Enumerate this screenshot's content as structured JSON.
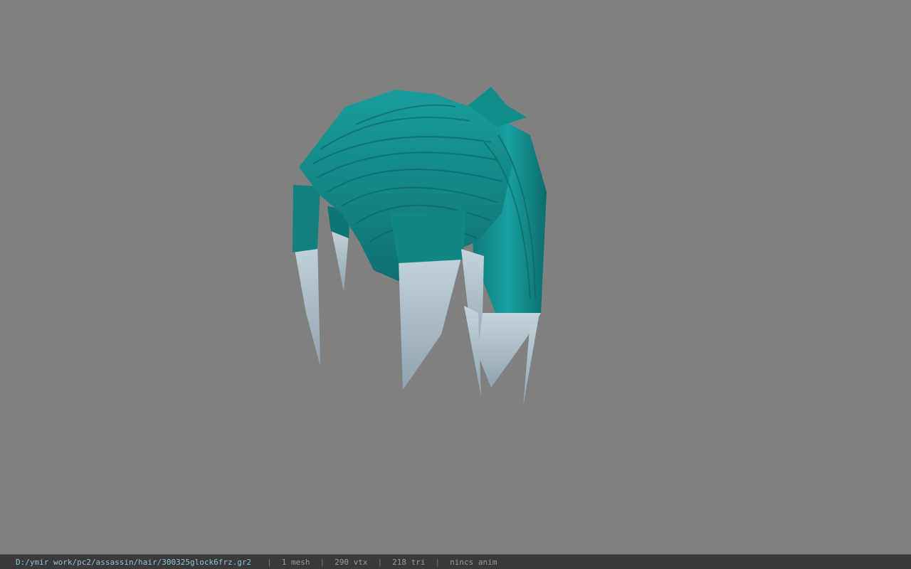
{
  "viewer": {
    "background_color": "#808080",
    "model": {
      "type": "hair-mesh",
      "hair_color": "#138b8b",
      "tip_color": "#b8c8d2"
    }
  },
  "status_bar": {
    "file_path": "D:/ymir work/pc2/assassin/hair/300325glock6frz.gr2",
    "separator": "|",
    "mesh_count": "1 mesh",
    "vertex_count": "290 vtx",
    "triangle_count": "218 tri",
    "anim_status": "nincs anim"
  }
}
